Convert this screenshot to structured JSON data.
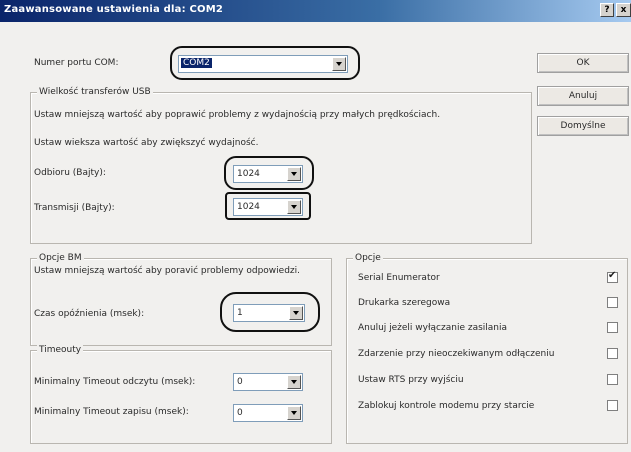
{
  "window": {
    "title": "Zaawansowane ustawienia dla: COM2",
    "help_button": "?",
    "close_button": "x"
  },
  "port": {
    "label": "Numer portu COM:",
    "value": "COM2"
  },
  "buttons": {
    "ok": "OK",
    "cancel": "Anuluj",
    "defaults": "Domyślne"
  },
  "usb": {
    "legend": "Wielkość transferów USB",
    "hint1": "Ustaw mniejszą wartość aby poprawić problemy z wydajnością przy małych prędkościach.",
    "hint2": "Ustaw wieksza wartość aby zwiększyć wydajność.",
    "receive_label": "Odbioru (Bajty):",
    "receive_value": "1024",
    "transmit_label": "Transmisji (Bajty):",
    "transmit_value": "1024"
  },
  "bm": {
    "legend": "Opcje BM",
    "hint": "Ustaw mniejszą wartość aby poravić problemy odpowiedzi.",
    "latency_label": "Czas opóźnienia (msek):",
    "latency_value": "1"
  },
  "timeouts": {
    "legend": "Timeouty",
    "read_label": "Minimalny Timeout odczytu (msek):",
    "read_value": "0",
    "write_label": "Minimalny Timeout zapisu (msek):",
    "write_value": "0"
  },
  "options": {
    "legend": "Opcje",
    "items": [
      {
        "label": "Serial Enumerator",
        "checked": true
      },
      {
        "label": "Drukarka szeregowa",
        "checked": false
      },
      {
        "label": "Anuluj jeżeli wyłączanie zasilania",
        "checked": false
      },
      {
        "label": "Zdarzenie przy nieoczekiwanym odłączeniu",
        "checked": false
      },
      {
        "label": "Ustaw RTS przy wyjściu",
        "checked": false
      },
      {
        "label": "Zablokuj kontrole modemu przy starcie",
        "checked": false
      }
    ]
  }
}
